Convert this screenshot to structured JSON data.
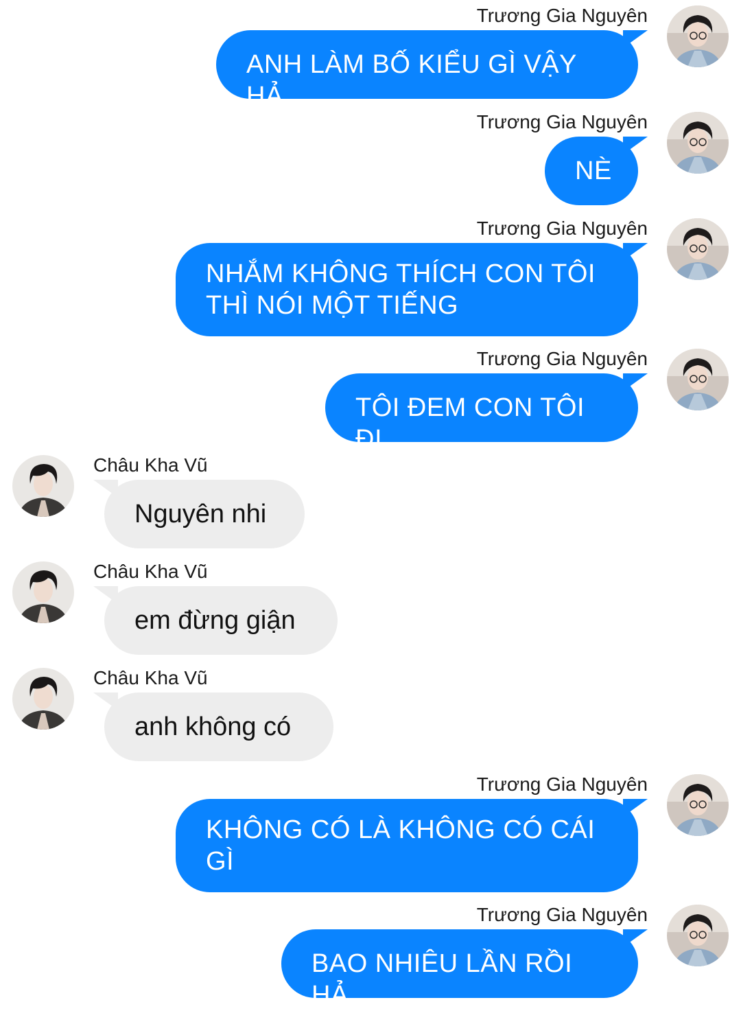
{
  "colors": {
    "outgoing_bubble": "#0a84ff",
    "incoming_bubble": "#ededed",
    "outgoing_text": "#ffffff",
    "incoming_text": "#111111"
  },
  "messages": [
    {
      "sender": "Trương Gia Nguyên",
      "text": "ANH LÀM BỐ KIỂU GÌ VẬY HẢ",
      "side": "right",
      "avatar_icon": "profile-photo"
    },
    {
      "sender": "Trương Gia Nguyên",
      "text": "NÈ",
      "side": "right",
      "avatar_icon": "profile-photo"
    },
    {
      "sender": "Trương Gia Nguyên",
      "text": "NHẮM KHÔNG THÍCH CON TÔI THÌ NÓI MỘT TIẾNG",
      "side": "right",
      "avatar_icon": "profile-photo"
    },
    {
      "sender": "Trương Gia Nguyên",
      "text": "TÔI ĐEM CON TÔI ĐI",
      "side": "right",
      "avatar_icon": "profile-photo"
    },
    {
      "sender": "Châu Kha Vũ",
      "text": "Nguyên nhi",
      "side": "left",
      "avatar_icon": "profile-photo"
    },
    {
      "sender": "Châu Kha Vũ",
      "text": "em đừng giận",
      "side": "left",
      "avatar_icon": "profile-photo"
    },
    {
      "sender": "Châu Kha Vũ",
      "text": "anh không có",
      "side": "left",
      "avatar_icon": "profile-photo"
    },
    {
      "sender": "Trương Gia Nguyên",
      "text": "KHÔNG CÓ LÀ KHÔNG CÓ CÁI GÌ",
      "side": "right",
      "avatar_icon": "profile-photo"
    },
    {
      "sender": "Trương Gia Nguyên",
      "text": "BAO NHIÊU LẦN RỒI HẢ",
      "side": "right",
      "avatar_icon": "profile-photo"
    }
  ]
}
